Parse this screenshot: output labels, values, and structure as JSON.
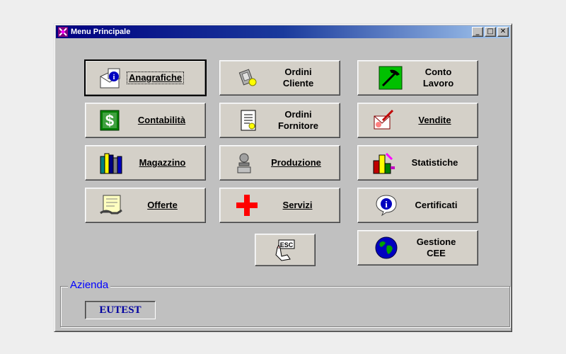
{
  "window": {
    "title": "Menu Principale",
    "controls": {
      "minimize": "_",
      "maximize": "□",
      "close": "✕"
    }
  },
  "buttons": {
    "anagrafiche": "Anagrafiche",
    "ordini_cliente": [
      "Ordini",
      "Cliente"
    ],
    "conto_lavoro": [
      "Conto",
      "Lavoro"
    ],
    "contabilita": "Contabilità",
    "ordini_fornitore": [
      "Ordini",
      "Fornitore"
    ],
    "vendite": "Vendite",
    "magazzino": "Magazzino",
    "produzione": "Produzione",
    "statistiche": "Statistiche",
    "offerte": "Offerte",
    "servizi": "Servizi",
    "certificati": "Certificati",
    "gestione_cee": [
      "Gestione",
      "CEE"
    ],
    "esc_icon_text": "ESC"
  },
  "azienda": {
    "label": "Azienda",
    "value": "EUTEST"
  },
  "colors": {
    "title_start": "#000080",
    "title_end": "#a6caf0",
    "face": "#c0c0c0",
    "legend_text": "#0000ff",
    "value_text": "#0000a0"
  }
}
